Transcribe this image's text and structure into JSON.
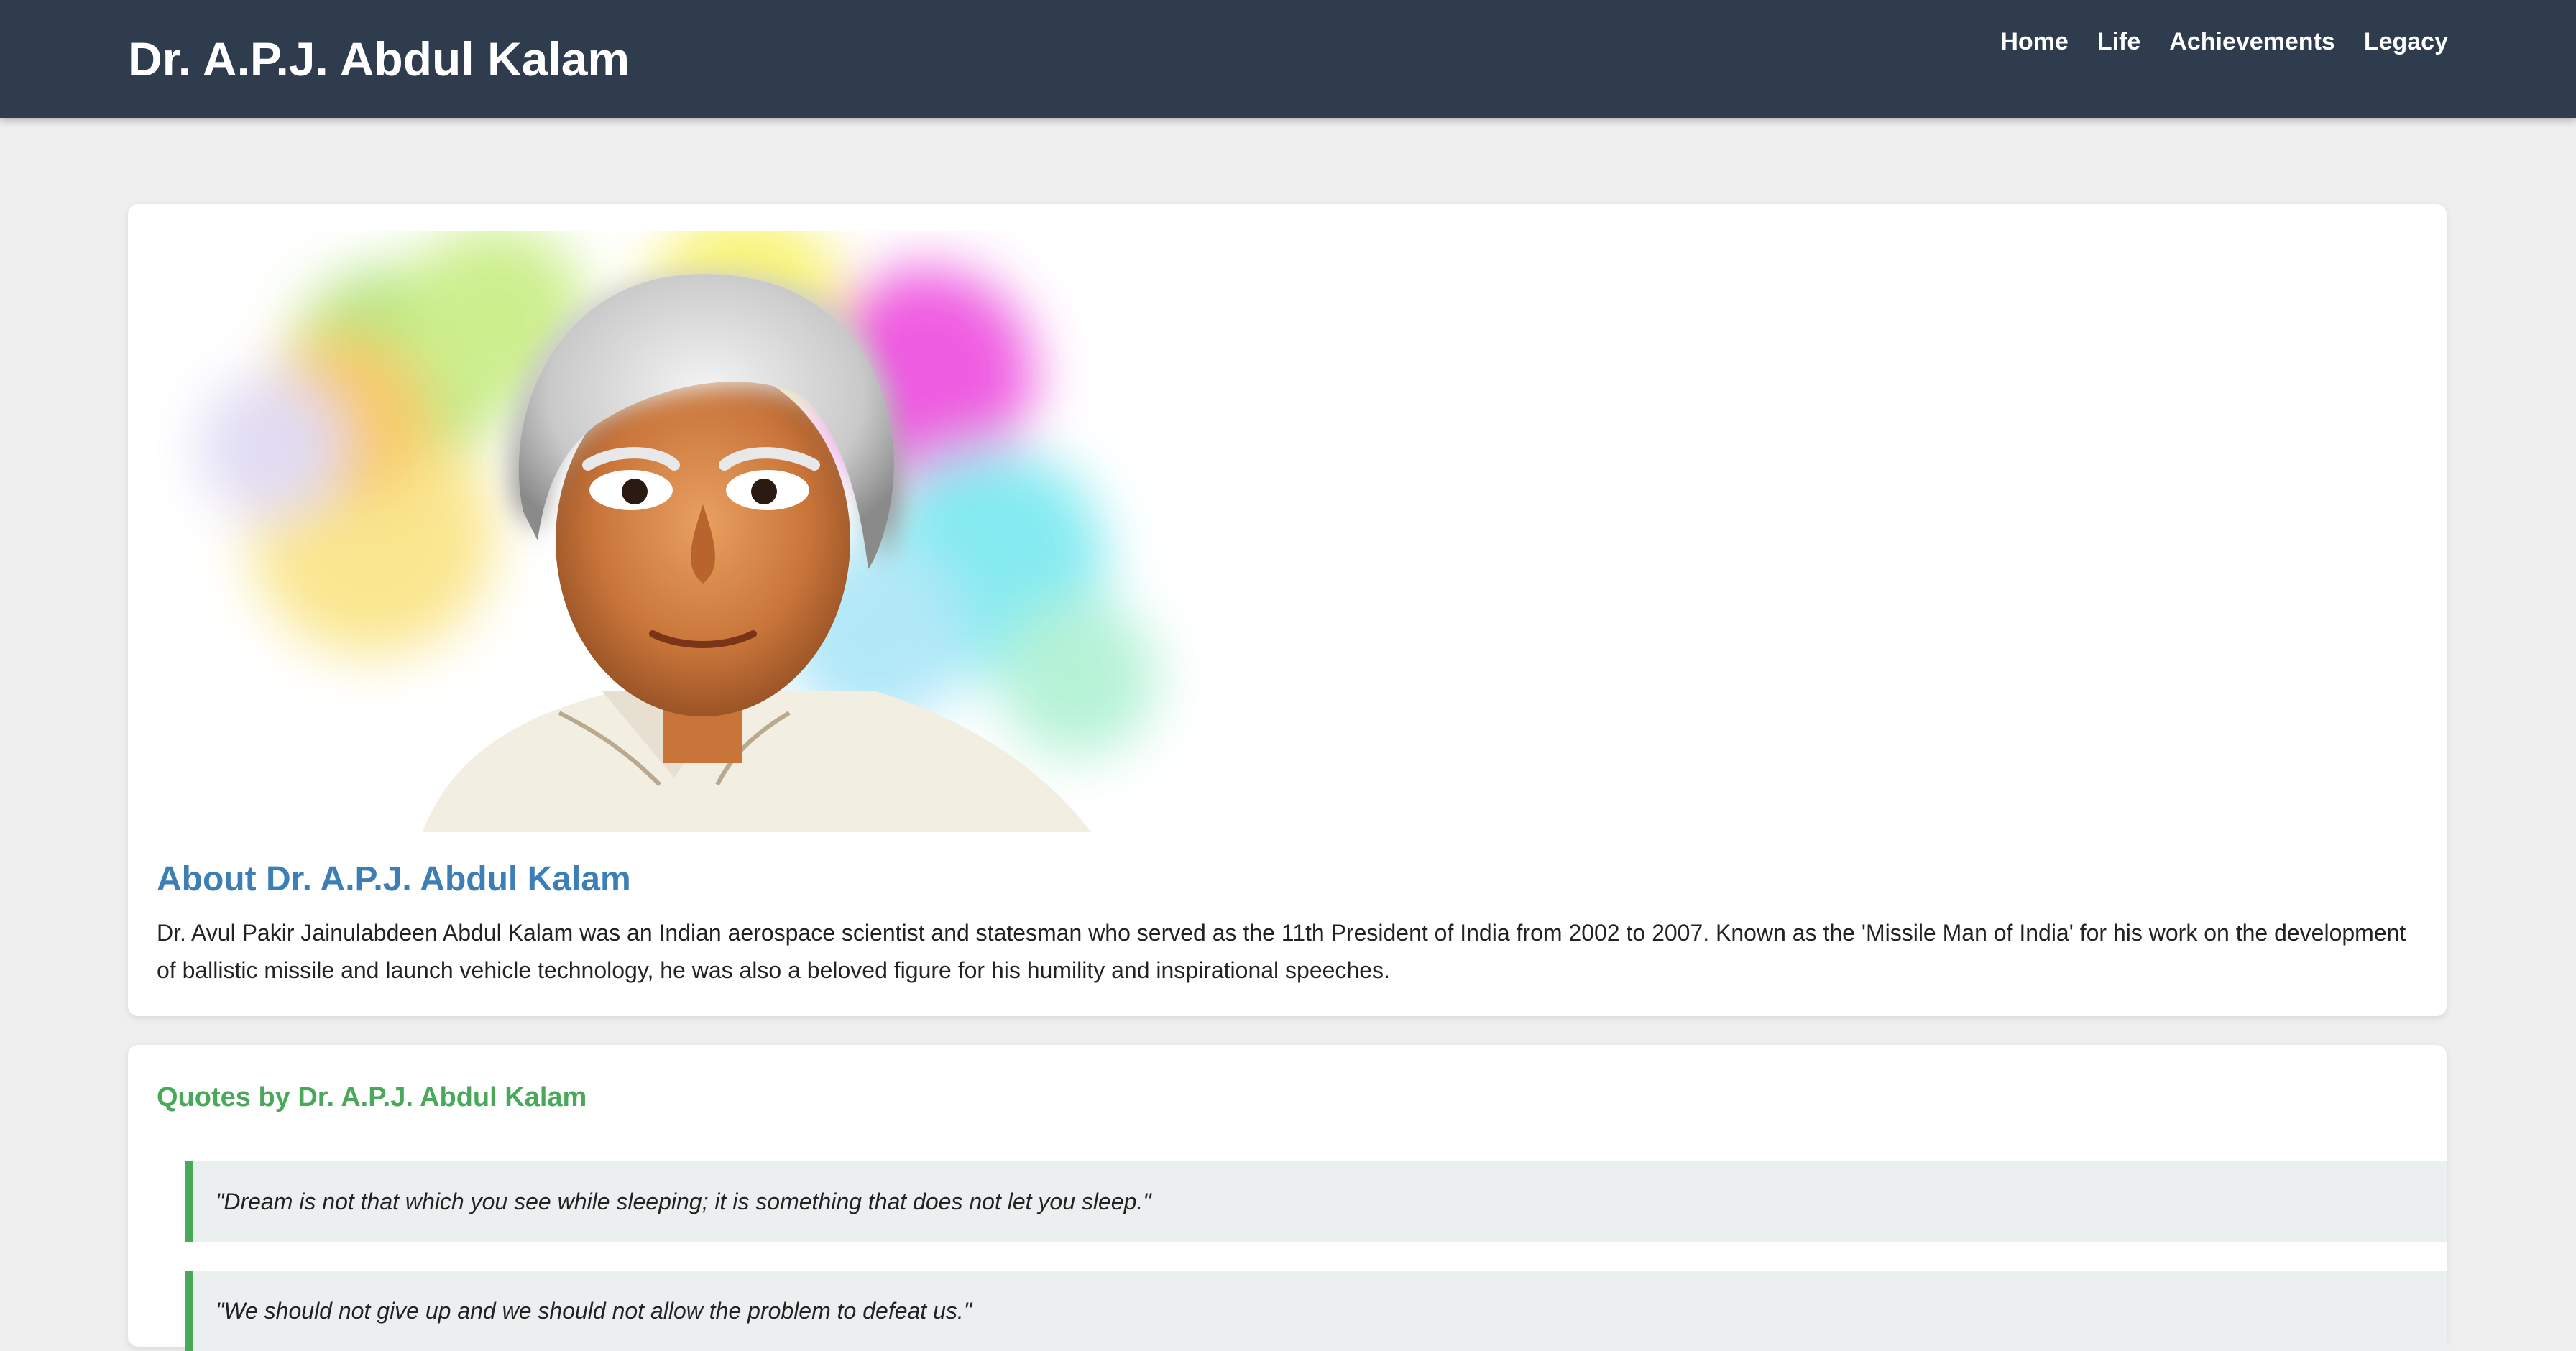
{
  "header": {
    "site_title": "Dr. A.P.J. Abdul Kalam",
    "nav": [
      "Home",
      "Life",
      "Achievements",
      "Legacy"
    ]
  },
  "about": {
    "image_icon": "portrait-illustration",
    "heading": "About Dr. A.P.J. Abdul Kalam",
    "text": "Dr. Avul Pakir Jainulabdeen Abdul Kalam was an Indian aerospace scientist and statesman who served as the 11th President of India from 2002 to 2007. Known as the 'Missile Man of India' for his work on the development of ballistic missile and launch vehicle technology, he was also a beloved figure for his humility and inspirational speeches."
  },
  "quotes": {
    "heading": "Quotes by Dr. A.P.J. Abdul Kalam",
    "items": [
      "\"Dream is not that which you see while sleeping; it is something that does not let you sleep.\"",
      "\"We should not give up and we should not allow the problem to defeat us.\""
    ]
  },
  "colors": {
    "nav_bg": "#2f3c4e",
    "about_heading": "#3d7fb5",
    "quotes_accent": "#49a85a",
    "page_bg": "#efefef"
  }
}
